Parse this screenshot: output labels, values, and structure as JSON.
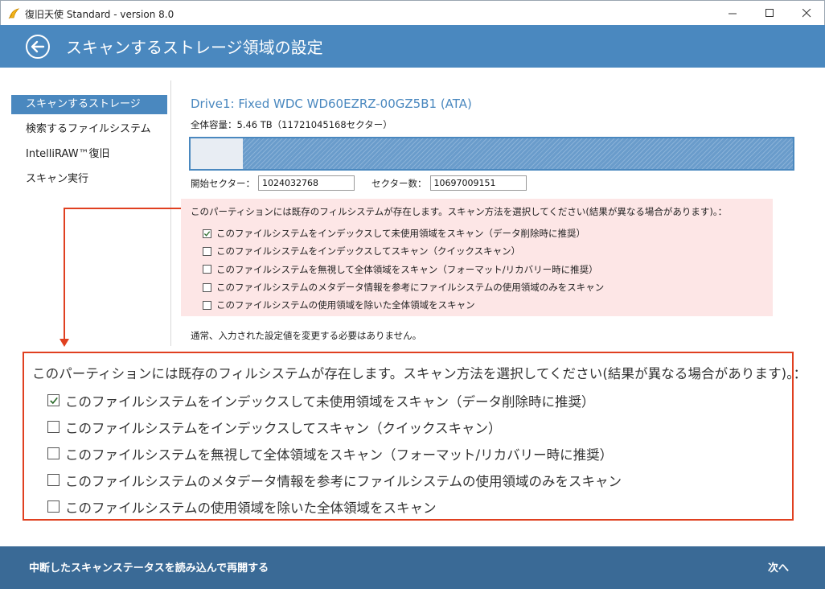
{
  "window": {
    "title": "復旧天使 Standard - version 8.0"
  },
  "header": {
    "title": "スキャンするストレージ領域の設定"
  },
  "sidebar": {
    "items": [
      {
        "label": "スキャンするストレージ",
        "active": true
      },
      {
        "label": "検索するファイルシステム",
        "active": false
      },
      {
        "label": "IntelliRAW™復旧",
        "active": false
      },
      {
        "label": "スキャン実行",
        "active": false
      }
    ]
  },
  "drive": {
    "name": "Drive1: Fixed WDC WD60EZRZ-00GZ5B1 (ATA)",
    "capacity": "全体容量：5.46 TB（11721045168セクター）",
    "used_fraction": 0.087
  },
  "sectors": {
    "start_label": "開始セクター：",
    "start_value": "1024032768",
    "count_label": "セクター数：",
    "count_value": "10697009151"
  },
  "scan_options": {
    "prompt": "このパーティションには既存のフィルシステムが存在します。スキャン方法を選択してください(結果が異なる場合があります)。：",
    "options": [
      {
        "label": "このファイルシステムをインデックスして未使用領域をスキャン（データ削除時に推奨）",
        "checked": true
      },
      {
        "label": "このファイルシステムをインデックスしてスキャン（クイックスキャン）",
        "checked": false
      },
      {
        "label": "このファイルシステムを無視して全体領域をスキャン（フォーマット/リカバリー時に推奨）",
        "checked": false
      },
      {
        "label": "このファイルシステムのメタデータ情報を参考にファイルシステムの使用領域のみをスキャン",
        "checked": false
      },
      {
        "label": "このファイルシステムの使用領域を除いた全体領域をスキャン",
        "checked": false
      }
    ]
  },
  "note": "通常、入力された設定値を変更する必要はありません。",
  "footer": {
    "resume_label": "中断したスキャンステータスを読み込んで再開する",
    "next_label": "次へ"
  },
  "colors": {
    "accent": "#4a88bf",
    "footer": "#3a6a96",
    "panel": "#fde6e6",
    "callout": "#e04020"
  }
}
